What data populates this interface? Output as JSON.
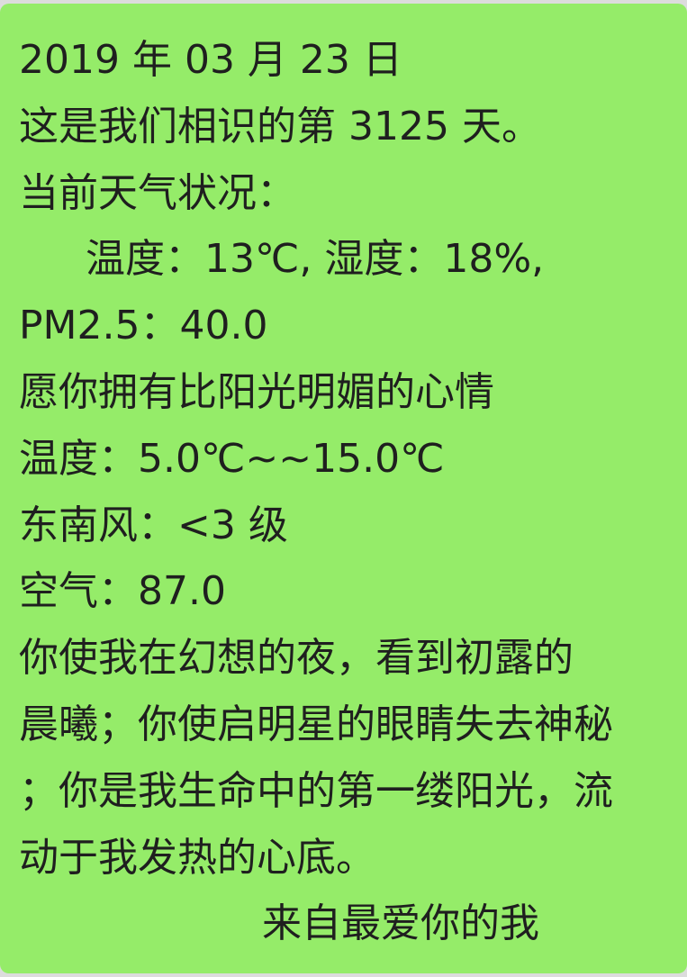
{
  "message": {
    "bubble_color": "#95ec69",
    "lines": [
      "2019 年 03 月 23 日",
      "这是我们相识的第 3125 天。",
      "当前天气状况：",
      "温度：13℃, 湿度：18%,",
      "PM2.5：40.0",
      "愿你拥有比阳光明媚的心情",
      "温度：5.0℃~~15.0℃",
      "东南风：<3 级",
      "空气：87.0",
      "你使我在幻想的夜，看到初露的",
      "晨曦；你使启明星的眼睛失去神秘",
      "；你是我生命中的第一缕阳光，流",
      "动于我发热的心底。",
      "来自最爱你的我"
    ]
  }
}
